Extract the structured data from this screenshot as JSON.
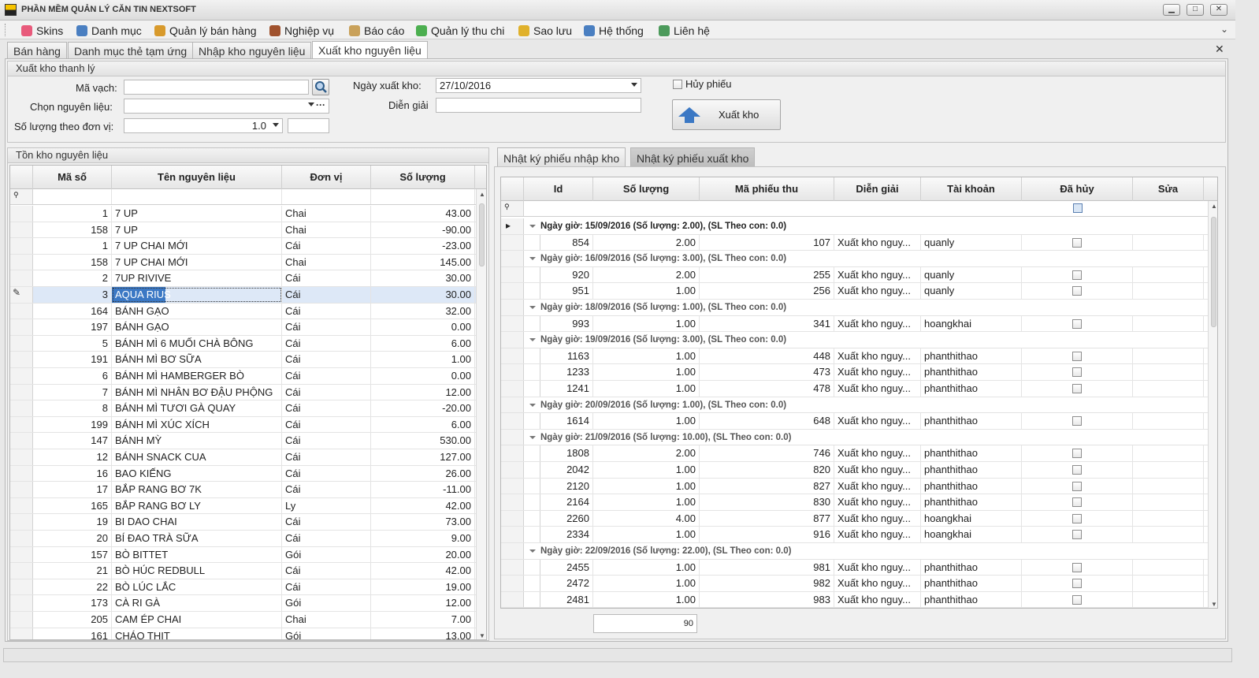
{
  "window": {
    "title": "PHẦN MỀM QUẢN LÝ CĂN TIN NEXTSOFT",
    "minimize": "▁",
    "maximize": "□",
    "close": "✕"
  },
  "menu": [
    {
      "label": "Skins",
      "icon": "palette-icon",
      "color": "#e85a7b"
    },
    {
      "label": "Danh mục",
      "icon": "grid-icon",
      "color": "#4a7fc1"
    },
    {
      "label": "Quản lý bán hàng",
      "icon": "tag-icon",
      "color": "#d89a2c"
    },
    {
      "label": "Nghiệp vụ",
      "icon": "briefcase-icon",
      "color": "#a0522d"
    },
    {
      "label": "Báo cáo",
      "icon": "clipboard-icon",
      "color": "#c9a15a"
    },
    {
      "label": "Quản lý thu chi",
      "icon": "money-icon",
      "color": "#4caf50"
    },
    {
      "label": "Sao lưu",
      "icon": "database-icon",
      "color": "#e0b12b"
    },
    {
      "label": "Hệ thống",
      "icon": "gears-icon",
      "color": "#4a7fc1"
    },
    {
      "label": "Liên hệ",
      "icon": "user-icon",
      "color": "#4c9a5b"
    }
  ],
  "tabs": [
    "Bán hàng",
    "Danh mục thẻ tạm ứng",
    "Nhập kho nguyên liệu",
    "Xuất kho nguyên liệu"
  ],
  "form": {
    "group_title": "Xuất kho thanh lý",
    "barcode_label": "Mã vạch:",
    "barcode_value": "",
    "material_label": "Chọn nguyên liệu:",
    "material_value": "",
    "qty_label": "Số lượng theo đơn vị:",
    "qty_value": "1.0",
    "qty_extra": "",
    "date_label": "Ngày xuất kho:",
    "date_value": "27/10/2016",
    "desc_label": "Diễn giải",
    "desc_value": "",
    "cancel_label": "Hủy phiếu",
    "export_button": "Xuất kho"
  },
  "stock": {
    "title": "Tồn kho nguyên liệu",
    "columns": [
      "Mã số",
      "Tên nguyên liệu",
      "Đơn vị",
      "Số lượng"
    ],
    "rows": [
      [
        "1",
        "7 UP",
        "Chai",
        "43.00"
      ],
      [
        "158",
        "7 UP",
        "Chai",
        "-90.00"
      ],
      [
        "1",
        "7 UP CHAI MỚI",
        "Cái",
        "-23.00"
      ],
      [
        "158",
        "7 UP CHAI MỚI",
        "Chai",
        "145.00"
      ],
      [
        "2",
        "7UP RIVIVE",
        "Cái",
        "30.00"
      ],
      [
        "3",
        "AQUA RIUS",
        "Cái",
        "30.00"
      ],
      [
        "164",
        "BÁNH GẠO",
        "Cái",
        "32.00"
      ],
      [
        "197",
        "BÁNH GẠO",
        "Cái",
        "0.00"
      ],
      [
        "5",
        "BÁNH MÌ 6 MUỐI CHÀ BÔNG",
        "Cái",
        "6.00"
      ],
      [
        "191",
        "BÁNH MÌ BƠ SỮA",
        "Cái",
        "1.00"
      ],
      [
        "6",
        "BÁNH MÌ HAMBERGER BÒ",
        "Cái",
        "0.00"
      ],
      [
        "7",
        "BÁNH MÌ NHÂN BƠ ĐẬU PHỘNG",
        "Cái",
        "12.00"
      ],
      [
        "8",
        "BÁNH MÌ TƯƠI GÀ QUAY",
        "Cái",
        "-20.00"
      ],
      [
        "199",
        "BÁNH MÌ XÚC XÍCH",
        "Cái",
        "6.00"
      ],
      [
        "147",
        "BÁNH MỲ",
        "Cái",
        "530.00"
      ],
      [
        "12",
        "BÁNH SNACK CUA",
        "Cái",
        "127.00"
      ],
      [
        "16",
        "BAO KIẾNG",
        "Cái",
        "26.00"
      ],
      [
        "17",
        "BẮP RANG BƠ 7K",
        "Cái",
        "-11.00"
      ],
      [
        "165",
        "BẮP RANG BƠ LY",
        "Ly",
        "42.00"
      ],
      [
        "19",
        "BI DAO CHAI",
        "Cái",
        "73.00"
      ],
      [
        "20",
        "BÍ ĐAO TRÀ SỮA",
        "Cái",
        "9.00"
      ],
      [
        "157",
        "BÒ BITTET",
        "Gói",
        "20.00"
      ],
      [
        "21",
        "BÒ HÚC REDBULL",
        "Cái",
        "42.00"
      ],
      [
        "22",
        "BÒ LÚC LẮC",
        "Cái",
        "19.00"
      ],
      [
        "173",
        "CÀ RI GÀ",
        "Gói",
        "12.00"
      ],
      [
        "205",
        "CAM ÉP CHAI",
        "Chai",
        "7.00"
      ],
      [
        "161",
        "CHÁO THỊT",
        "Gói",
        "13.00"
      ]
    ],
    "selected_index": 5
  },
  "log": {
    "tabs": [
      "Nhật ký phiếu nhập kho",
      "Nhật ký phiếu xuất kho"
    ],
    "active_tab": 1,
    "columns": [
      "Id",
      "Số lượng",
      "Mã phiếu thu",
      "Diễn giải",
      "Tài khoản",
      "Đã hủy",
      "Sửa"
    ],
    "groups": [
      {
        "header": "Ngày giờ: 15/09/2016 (Số lượng: 2.00), (SL Theo con: 0.0)",
        "rows": [
          [
            "854",
            "2.00",
            "107",
            "Xuất kho nguy...",
            "quanly"
          ]
        ]
      },
      {
        "header": "Ngày giờ: 16/09/2016 (Số lượng: 3.00), (SL Theo con: 0.0)",
        "rows": [
          [
            "920",
            "2.00",
            "255",
            "Xuất kho nguy...",
            "quanly"
          ],
          [
            "951",
            "1.00",
            "256",
            "Xuất kho nguy...",
            "quanly"
          ]
        ]
      },
      {
        "header": "Ngày giờ: 18/09/2016 (Số lượng: 1.00), (SL Theo con: 0.0)",
        "rows": [
          [
            "993",
            "1.00",
            "341",
            "Xuất kho nguy...",
            "hoangkhai"
          ]
        ]
      },
      {
        "header": "Ngày giờ: 19/09/2016 (Số lượng: 3.00), (SL Theo con: 0.0)",
        "rows": [
          [
            "1163",
            "1.00",
            "448",
            "Xuất kho nguy...",
            "phanthithao"
          ],
          [
            "1233",
            "1.00",
            "473",
            "Xuất kho nguy...",
            "phanthithao"
          ],
          [
            "1241",
            "1.00",
            "478",
            "Xuất kho nguy...",
            "phanthithao"
          ]
        ]
      },
      {
        "header": "Ngày giờ: 20/09/2016 (Số lượng: 1.00), (SL Theo con: 0.0)",
        "rows": [
          [
            "1614",
            "1.00",
            "648",
            "Xuất kho nguy...",
            "phanthithao"
          ]
        ]
      },
      {
        "header": "Ngày giờ: 21/09/2016 (Số lượng: 10.00), (SL Theo con: 0.0)",
        "rows": [
          [
            "1808",
            "2.00",
            "746",
            "Xuất kho nguy...",
            "phanthithao"
          ],
          [
            "2042",
            "1.00",
            "820",
            "Xuất kho nguy...",
            "phanthithao"
          ],
          [
            "2120",
            "1.00",
            "827",
            "Xuất kho nguy...",
            "phanthithao"
          ],
          [
            "2164",
            "1.00",
            "830",
            "Xuất kho nguy...",
            "phanthithao"
          ],
          [
            "2260",
            "4.00",
            "877",
            "Xuất kho nguy...",
            "hoangkhai"
          ],
          [
            "2334",
            "1.00",
            "916",
            "Xuất kho nguy...",
            "hoangkhai"
          ]
        ]
      },
      {
        "header": "Ngày giờ: 22/09/2016 (Số lượng: 22.00), (SL Theo con: 0.0)",
        "rows": [
          [
            "2455",
            "1.00",
            "981",
            "Xuất kho nguy...",
            "phanthithao"
          ],
          [
            "2472",
            "1.00",
            "982",
            "Xuất kho nguy...",
            "phanthithao"
          ],
          [
            "2481",
            "1.00",
            "983",
            "Xuất kho nguy...",
            "phanthithao"
          ]
        ]
      }
    ],
    "footer_total": "90"
  }
}
